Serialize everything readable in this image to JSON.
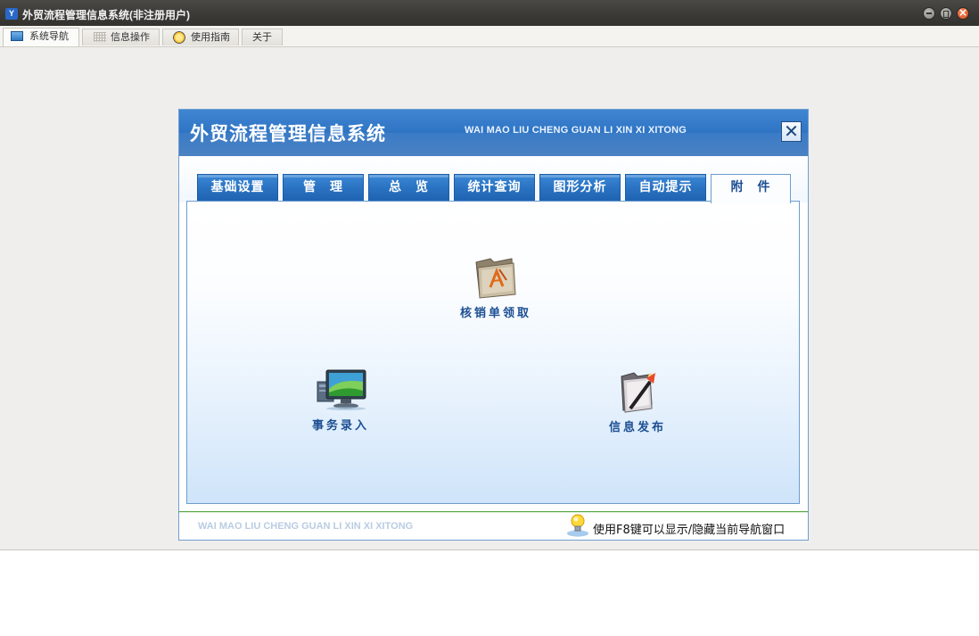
{
  "window": {
    "icon_text": "Y",
    "title": "外贸流程管理信息系统(非注册用户)"
  },
  "menu": {
    "tabs": [
      {
        "label": "系统导航",
        "icon": "monitor-icon",
        "active": true
      },
      {
        "label": "信息操作",
        "icon": "grid-icon",
        "active": false
      },
      {
        "label": "使用指南",
        "icon": "help-icon",
        "active": false
      },
      {
        "label": "关于",
        "icon": "",
        "active": false
      }
    ]
  },
  "panel": {
    "title": "外贸流程管理信息系统",
    "subtitle": "WAI MAO LIU CHENG GUAN LI XIN XI XITONG",
    "close_glyph": "✕",
    "category_tabs": [
      {
        "label": "基础设置",
        "active": false
      },
      {
        "label": "管　理",
        "active": false
      },
      {
        "label": "总　览",
        "active": false
      },
      {
        "label": "统计查询",
        "active": false
      },
      {
        "label": "图形分析",
        "active": false
      },
      {
        "label": "自动提示",
        "active": false
      },
      {
        "label": "附　件",
        "active": true
      }
    ],
    "items": [
      {
        "label": "核销单领取",
        "icon": "folder-app-icon"
      },
      {
        "label": "事务录入",
        "icon": "computer-monitor-icon"
      },
      {
        "label": "信息发布",
        "icon": "pen-folder-icon"
      }
    ],
    "footer_left": "WAI MAO LIU CHENG GUAN LI XIN XI XITONG",
    "footer_hint": "使用F8键可以显示/隐藏当前导航窗口",
    "footer_icon": "lightbulb-icon"
  },
  "colors": {
    "header_blue": "#2d72c2",
    "tab_blue": "#2a73c2",
    "label_blue": "#1c4f92",
    "footer_green": "#5aa845"
  }
}
